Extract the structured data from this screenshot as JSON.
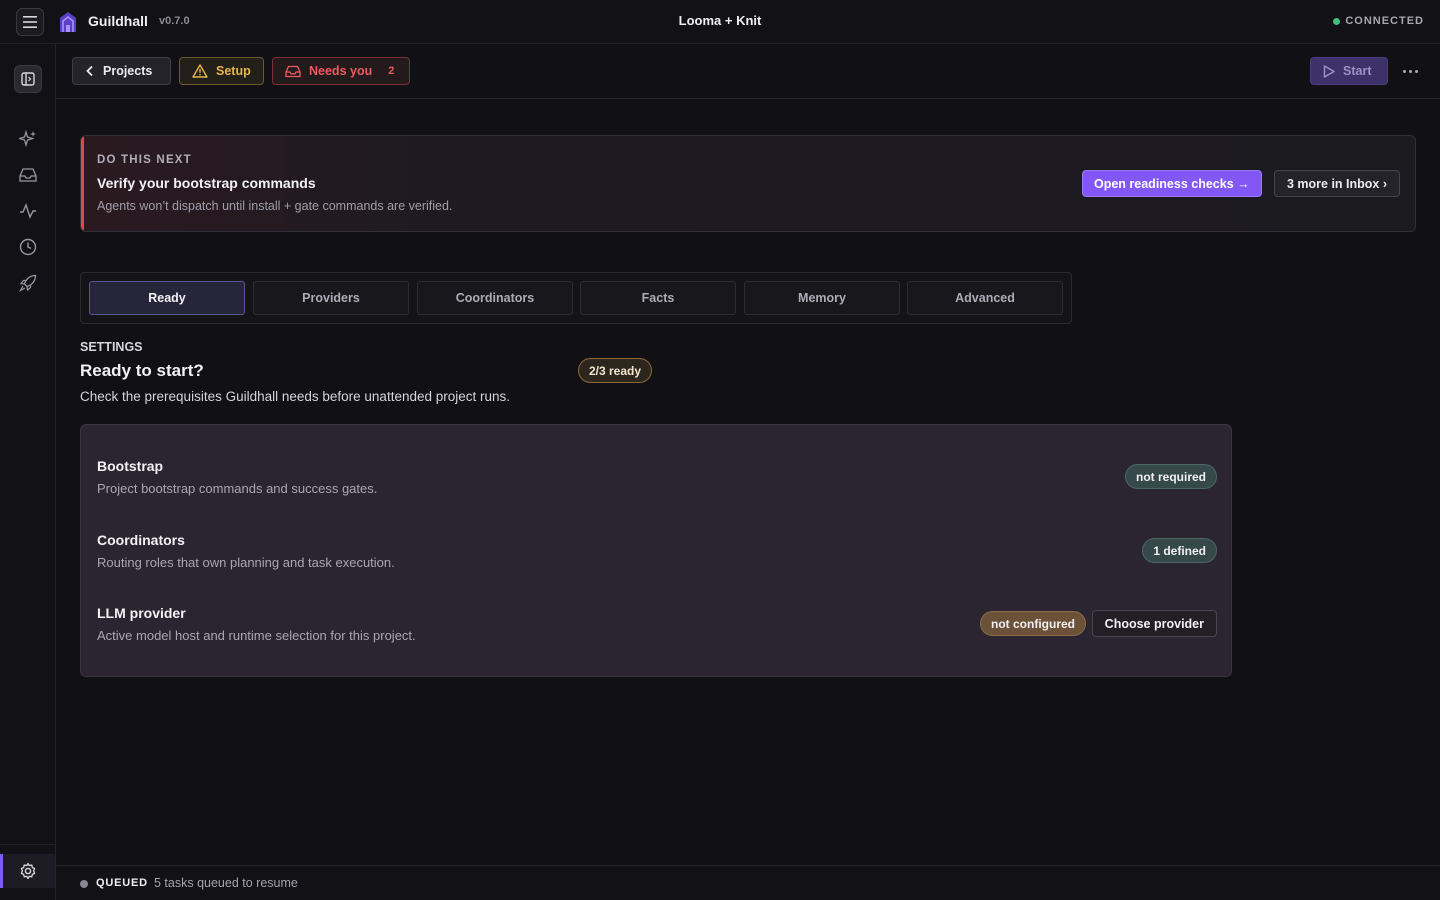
{
  "app": {
    "name": "Guildhall",
    "version": "v0.7.0",
    "window_title": "Looma + Knit",
    "connection_status": "CONNECTED",
    "connection_color": "#3fbf7f",
    "brand_color": "#7c5cf0"
  },
  "sidebar": {
    "items": [
      {
        "icon": "sparkles-icon"
      },
      {
        "icon": "inbox-icon"
      },
      {
        "icon": "activity-icon"
      },
      {
        "icon": "clock-icon"
      },
      {
        "icon": "rocket-icon"
      }
    ],
    "bottom_item": {
      "icon": "gear-icon",
      "active": true
    }
  },
  "toolbar": {
    "projects_label": "Projects",
    "setup_label": "Setup",
    "needs_you_label": "Needs you",
    "needs_you_count": "2",
    "start_label": "Start"
  },
  "banner": {
    "kicker": "DO THIS NEXT",
    "title": "Verify your bootstrap commands",
    "description": "Agents won’t dispatch until install + gate commands are verified.",
    "primary_action": "Open readiness checks →",
    "secondary_action": "3 more in Inbox ›",
    "accent_color": "#e0474d"
  },
  "tabs": [
    {
      "label": "Ready",
      "active": true
    },
    {
      "label": "Providers",
      "active": false
    },
    {
      "label": "Coordinators",
      "active": false
    },
    {
      "label": "Facts",
      "active": false
    },
    {
      "label": "Memory",
      "active": false
    },
    {
      "label": "Advanced",
      "active": false
    }
  ],
  "settings": {
    "kicker": "SETTINGS",
    "title": "Ready to start?",
    "ready_badge": "2/3 ready",
    "description": "Check the prerequisites Guildhall needs before unattended project runs.",
    "rows": [
      {
        "title": "Bootstrap",
        "description": "Project bootstrap commands and success gates.",
        "status": "not required"
      },
      {
        "title": "Coordinators",
        "description": "Routing roles that own planning and task execution.",
        "status": "1 defined"
      },
      {
        "title": "LLM provider",
        "description": "Active model host and runtime selection for this project.",
        "status": "not configured",
        "action": "Choose provider"
      }
    ]
  },
  "footer": {
    "status_label": "QUEUED",
    "status_text": "5 tasks queued to resume"
  }
}
